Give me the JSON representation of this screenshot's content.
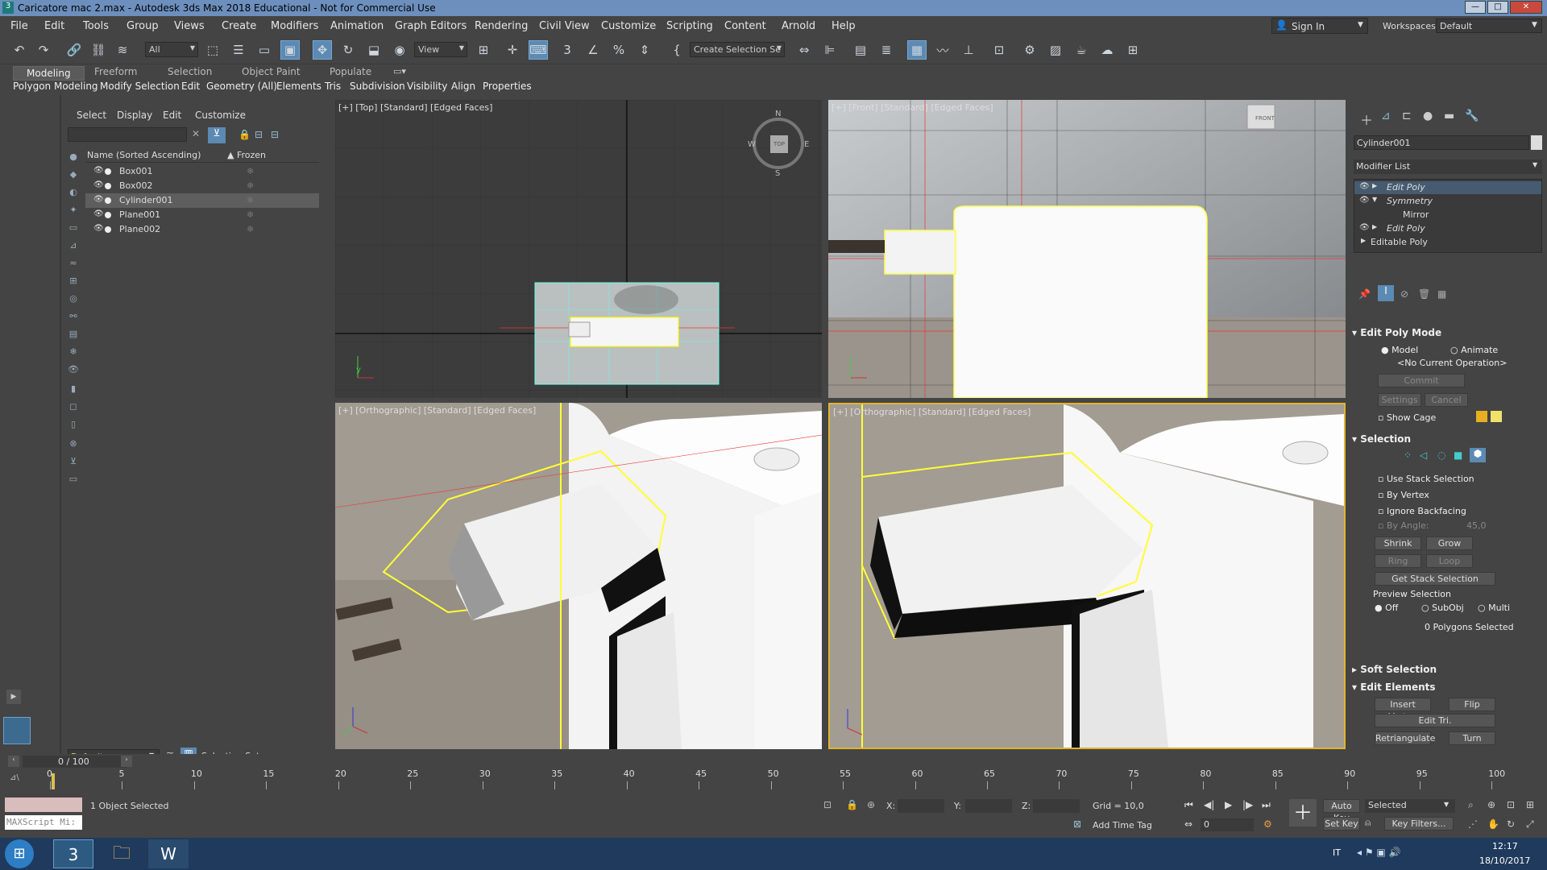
{
  "window": {
    "title": "Caricatore mac 2.max - Autodesk 3ds Max 2018 Educational - Not for Commercial Use"
  },
  "menu": [
    "File",
    "Edit",
    "Tools",
    "Group",
    "Views",
    "Create",
    "Modifiers",
    "Animation",
    "Graph Editors",
    "Rendering",
    "Civil View",
    "Customize",
    "Scripting",
    "Content",
    "Arnold",
    "Help"
  ],
  "account": {
    "signin": "Sign In",
    "workspaces_label": "Workspaces:",
    "workspace": "Default"
  },
  "toolbar": {
    "filter": "All",
    "view": "View",
    "selection_set": "Create Selection Se"
  },
  "ribbon": {
    "tabs": [
      "Modeling",
      "Freeform",
      "Selection",
      "Object Paint",
      "Populate"
    ],
    "sub": [
      "Polygon Modeling",
      "Modify Selection",
      "Edit",
      "Geometry (All)",
      "Elements",
      "Tris",
      "Subdivision",
      "Visibility",
      "Align",
      "Properties"
    ]
  },
  "scene": {
    "menu": [
      "Select",
      "Display",
      "Edit",
      "Customize"
    ],
    "col_name": "Name (Sorted Ascending)",
    "col_frozen": "▲ Frozen",
    "objects": [
      "Box001",
      "Box002",
      "Cylinder001",
      "Plane001",
      "Plane002"
    ],
    "selected": "Cylinder001",
    "layer": "Default",
    "selection_set_label": "Selection Set:"
  },
  "viewports": {
    "top": "[+] [Top] [Standard] [Edged Faces]",
    "front": "[+] [Front] [Standard] [Edged Faces]",
    "persp1": "[+] [Orthographic] [Standard] [Edged Faces]",
    "persp2": "[+] [Orthographic] [Standard] [Edged Faces]",
    "compass": {
      "n": "N",
      "s": "S",
      "e": "E",
      "w": "W",
      "top": "TOP"
    },
    "cube_front": "FRONT"
  },
  "cmd": {
    "object_name": "Cylinder001",
    "modifier_list": "Modifier List",
    "stack": [
      "Edit Poly",
      "Symmetry",
      "Mirror",
      "Edit Poly",
      "Editable Poly"
    ],
    "edit_poly_mode": "Edit Poly Mode",
    "model": "Model",
    "animate": "Animate",
    "no_op": "<No Current Operation>",
    "commit": "Commit",
    "settings": "Settings",
    "cancel": "Cancel",
    "show_cage": "Show Cage",
    "selection": "Selection",
    "use_stack": "Use Stack Selection",
    "by_vertex": "By Vertex",
    "ignore_backfacing": "Ignore Backfacing",
    "by_angle": "By Angle:",
    "angle_val": "45,0",
    "shrink": "Shrink",
    "grow": "Grow",
    "ring": "Ring",
    "loop": "Loop",
    "get_stack": "Get Stack Selection",
    "preview": "Preview Selection",
    "off": "Off",
    "subobj": "SubObj",
    "multi": "Multi",
    "poly_count": "0 Polygons Selected",
    "soft_sel": "Soft Selection",
    "edit_elements": "Edit Elements",
    "insert_vertex": "Insert Vertex",
    "flip": "Flip",
    "edit_tri": "Edit Tri.",
    "retriangulate": "Retriangulate",
    "turn": "Turn"
  },
  "timeline": {
    "frame": "0 / 100",
    "ticks": [
      "0",
      "5",
      "10",
      "15",
      "20",
      "25",
      "30",
      "35",
      "40",
      "45",
      "50",
      "55",
      "60",
      "65",
      "70",
      "75",
      "80",
      "85",
      "90",
      "95",
      "100"
    ]
  },
  "status": {
    "maxscript": "MAXScript Mi:",
    "selected": "1 Object Selected",
    "x": "X:",
    "y": "Y:",
    "z": "Z:",
    "grid": "Grid = 10,0",
    "add_time_tag": "Add Time Tag",
    "autokey": "Auto Key",
    "setkey": "Set Key",
    "key_mode": "Selected",
    "key_filters": "Key Filters...",
    "frame_val": "0"
  },
  "taskbar": {
    "lang": "IT",
    "time": "12:17",
    "date": "18/10/2017"
  }
}
